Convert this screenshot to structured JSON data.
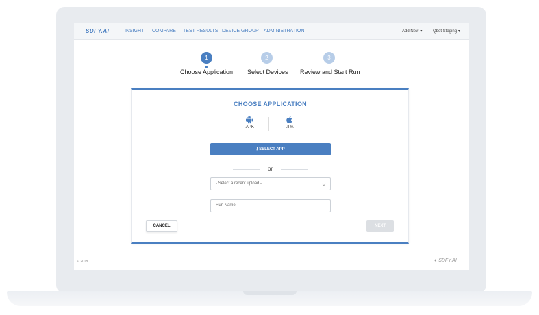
{
  "nav": {
    "logo": "SDFY.AI",
    "links": [
      "INSIGHT",
      "COMPARE",
      "TEST RESULTS",
      "DEVICE GROUP",
      "ADMINISTRATION"
    ],
    "add_new": "Add New",
    "environment": "Qbot Staging"
  },
  "steps": [
    {
      "number": "1",
      "label": "Choose Application",
      "active": true
    },
    {
      "number": "2",
      "label": "Select Devices",
      "active": false
    },
    {
      "number": "3",
      "label": "Review and Start Run",
      "active": false
    }
  ],
  "card": {
    "title": "CHOOSE APPLICATION",
    "platforms": [
      {
        "label": ".APK",
        "icon": "android-icon"
      },
      {
        "label": ".IPA",
        "icon": "apple-icon"
      }
    ],
    "select_app_label": "SELECT APP",
    "or_label": "or",
    "recent_upload_value": "- Select a recent upload -",
    "run_name_placeholder": "Run Name",
    "cancel_label": "CANCEL",
    "next_label": "NEXT"
  },
  "footer": {
    "copyright": "© 2018",
    "logo": "SDFY.AI"
  },
  "colors": {
    "accent": "#4a7fc1",
    "inactive_step": "#b7cde8",
    "disabled_button": "#dcdfe3"
  }
}
